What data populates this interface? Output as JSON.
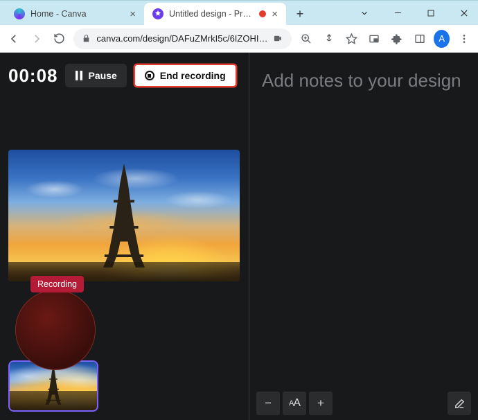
{
  "window": {
    "controls": [
      "dropdown",
      "minimize",
      "maximize",
      "close"
    ]
  },
  "tabs": {
    "items": [
      {
        "title": "Home - Canva",
        "active": false
      },
      {
        "title": "Untitled design - Prese",
        "active": true,
        "recording": true
      }
    ],
    "new_tab_icon": "plus-icon"
  },
  "toolbar": {
    "url": "canva.com/design/DAFuZMrkI5c/6IZOHI…",
    "icons": [
      "back",
      "forward",
      "reload",
      "lock",
      "camera",
      "zoom",
      "share",
      "star",
      "picture-in-picture",
      "extensions",
      "sidepanel"
    ],
    "profile_initial": "A",
    "menu_icon": "kebab"
  },
  "recorder": {
    "timer": "00:08",
    "pause_label": "Pause",
    "end_label": "End recording",
    "status_badge": "Recording"
  },
  "notes": {
    "placeholder": "Add notes to your design"
  },
  "bottom": {
    "zoom_out": "−",
    "font_size": "aA",
    "zoom_in": "+",
    "edit_icon": "compose-icon"
  },
  "slide": {
    "subject": "Eiffel Tower at sunset"
  }
}
